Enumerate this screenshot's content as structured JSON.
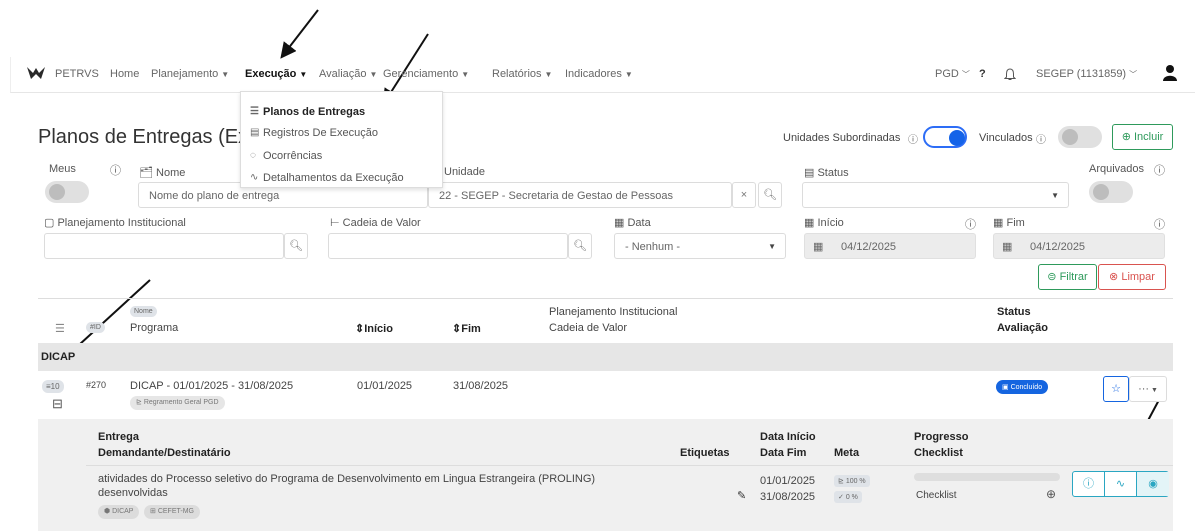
{
  "nav": {
    "brand": "PETRVS",
    "items": [
      "Home",
      "Planejamento",
      "Execução",
      "Avaliação",
      "Gerenciamento",
      "Relatórios",
      "Indicadores"
    ],
    "pgd": "PGD",
    "help": "?",
    "user": "SEGEP (1131859)"
  },
  "menu": {
    "items": [
      "Planos de Entregas",
      "Registros De Execução",
      "Ocorrências",
      "Detalhamentos da Execução"
    ]
  },
  "page": {
    "title": "Planos de Entregas (Ex"
  },
  "toolbar": {
    "unidades_subordinadas": "Unidades Subordinadas",
    "vinculados": "Vinculados",
    "incluir": "Incluir"
  },
  "filters": {
    "meus": "Meus",
    "nome_label": "Nome",
    "nome_placeholder": "Nome do plano de entrega",
    "unidade_label": "Unidade",
    "unidade_value": "22 - SEGEP - Secretaria de Gestao de Pessoas",
    "clear": "×",
    "status_label": "Status",
    "arquivados": "Arquivados",
    "planejamento_label": "Planejamento Institucional",
    "cadeia_label": "Cadeia de Valor",
    "data_label": "Data",
    "data_value": "- Nenhum -",
    "inicio_label": "Início",
    "inicio_value": "04/12/2025",
    "fim_label": "Fim",
    "fim_value": "04/12/2025",
    "filtrar": "Filtrar",
    "limpar": "Limpar"
  },
  "table": {
    "headers": {
      "id": "#ID",
      "nome_pill": "Nome",
      "programa": "Programa",
      "inicio": "Início",
      "fim": "Fim",
      "planejamento": "Planejamento Institucional",
      "cadeia": "Cadeia de Valor",
      "status": "Status",
      "avaliacao": "Avaliação"
    },
    "group": "DICAP",
    "row": {
      "count": "10",
      "id": "#270",
      "nome": "DICAP - 01/01/2025 - 31/08/2025",
      "regramento": "Regramento Geral PGD",
      "inicio": "01/01/2025",
      "fim": "31/08/2025",
      "status": "Concluído",
      "more": "···"
    }
  },
  "entregas": {
    "headers": {
      "entrega": "Entrega",
      "demandante": "Demandante/Destinatário",
      "etiquetas": "Etiquetas",
      "data_inicio": "Data Início",
      "data_fim": "Data Fim",
      "meta": "Meta",
      "progresso": "Progresso",
      "checklist": "Checklist"
    },
    "row": {
      "line1": "atividades do Processo seletivo do Programa de Desenvolvimento em Lingua Estrangeira (PROLING)",
      "line2": "desenvolvidas",
      "tag1": "DICAP",
      "tag2": "CEFET-MG",
      "inicio": "01/01/2025",
      "fim": "31/08/2025",
      "meta1": "100 %",
      "meta2": "0 %",
      "checklist": "Checklist"
    }
  }
}
